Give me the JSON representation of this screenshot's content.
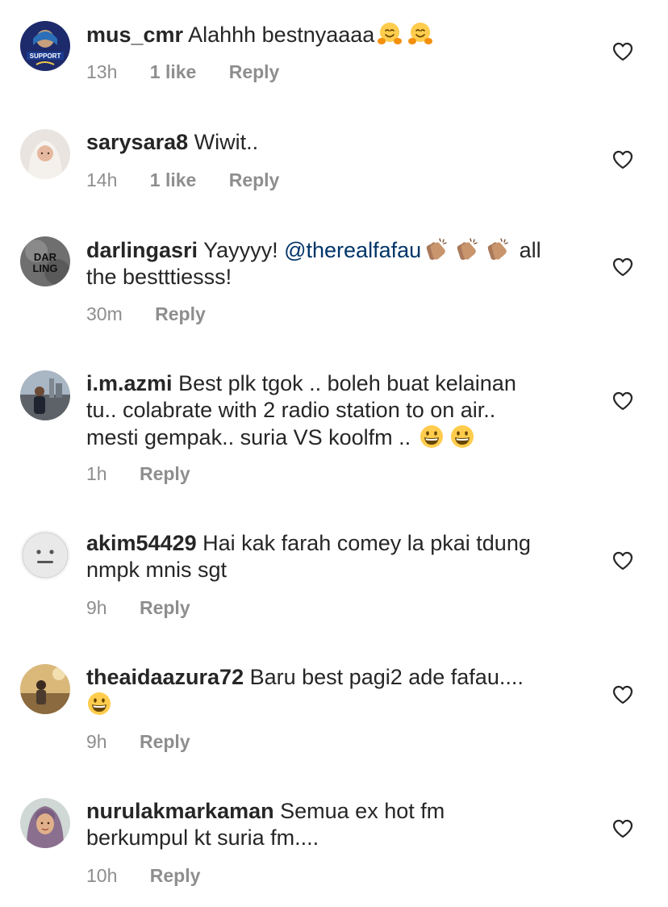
{
  "colors": {
    "text": "#262626",
    "meta": "#8e8e8e",
    "mention": "#003569"
  },
  "comments": [
    {
      "username": "mus_cmr",
      "text_1": "Alahhh bestnyaaaa",
      "emojis": [
        "hugging-face",
        "hugging-face"
      ],
      "time": "13h",
      "likes": "1 like",
      "reply": "Reply"
    },
    {
      "username": "sarysara8",
      "text_1": "Wiwit..",
      "time": "14h",
      "likes": "1 like",
      "reply": "Reply"
    },
    {
      "username": "darlingasri",
      "text_1": "Yayyyy!",
      "mention": "@therealfafau",
      "emojis": [
        "clapping-hands",
        "clapping-hands",
        "clapping-hands"
      ],
      "text_2": "all",
      "text_3": "the bestttiesss!",
      "time": "30m",
      "reply": "Reply"
    },
    {
      "username": "i.m.azmi",
      "text_1": "Best plk tgok .. boleh buat kelainan",
      "text_2": "tu.. colabrate with 2 radio station to on air..",
      "text_3": "mesti gempak.. suria VS koolfm ..",
      "emojis": [
        "grinning-face",
        "grinning-face"
      ],
      "time": "1h",
      "reply": "Reply"
    },
    {
      "username": "akim54429",
      "text_1": "Hai kak farah comey la pkai tdung",
      "text_2": "nmpk mnis sgt",
      "time": "9h",
      "reply": "Reply"
    },
    {
      "username": "theaidaazura72",
      "text_1": "Baru best pagi2 ade fafau....",
      "emojis": [
        "grinning-face"
      ],
      "time": "9h",
      "reply": "Reply"
    },
    {
      "username": "nurulakmarkaman",
      "text_1": "Semua ex hot fm",
      "text_2": "berkumpul kt suria fm....",
      "time": "10h",
      "reply": "Reply"
    }
  ]
}
